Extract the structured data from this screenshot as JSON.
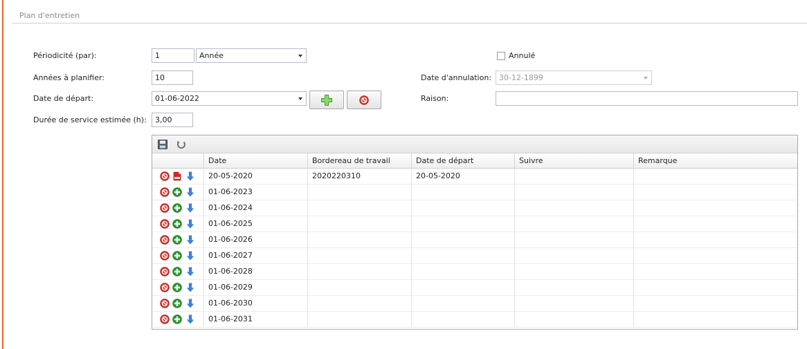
{
  "section": {
    "title": "Plan d'entretien"
  },
  "form": {
    "periodicity_label": "Périodicité (par):",
    "periodicity_value": "1",
    "periodicity_unit": "Année",
    "years_label": "Années à planifier:",
    "years_value": "10",
    "start_date_label": "Date de départ:",
    "start_date_value": "01-06-2022",
    "duration_label": "Durée de service estimée (h):",
    "duration_value": "3,00",
    "cancelled_label": "Annulé",
    "cancel_date_label": "Date d'annulation:",
    "cancel_date_value": "30-12-1899",
    "reason_label": "Raison:",
    "reason_value": ""
  },
  "grid": {
    "columns": [
      "Date",
      "Bordereau de travail",
      "Date de départ",
      "Suivre",
      "Remarque"
    ],
    "rows": [
      {
        "date": "20-05-2020",
        "work_order": "2020220310",
        "start_date": "20-05-2020",
        "follow": "",
        "remark": "",
        "type": "pdf"
      },
      {
        "date": "01-06-2023",
        "work_order": "",
        "start_date": "",
        "follow": "",
        "remark": "",
        "type": "add"
      },
      {
        "date": "01-06-2024",
        "work_order": "",
        "start_date": "",
        "follow": "",
        "remark": "",
        "type": "add"
      },
      {
        "date": "01-06-2025",
        "work_order": "",
        "start_date": "",
        "follow": "",
        "remark": "",
        "type": "add"
      },
      {
        "date": "01-06-2026",
        "work_order": "",
        "start_date": "",
        "follow": "",
        "remark": "",
        "type": "add"
      },
      {
        "date": "01-06-2027",
        "work_order": "",
        "start_date": "",
        "follow": "",
        "remark": "",
        "type": "add"
      },
      {
        "date": "01-06-2028",
        "work_order": "",
        "start_date": "",
        "follow": "",
        "remark": "",
        "type": "add"
      },
      {
        "date": "01-06-2029",
        "work_order": "",
        "start_date": "",
        "follow": "",
        "remark": "",
        "type": "add"
      },
      {
        "date": "01-06-2030",
        "work_order": "",
        "start_date": "",
        "follow": "",
        "remark": "",
        "type": "add"
      },
      {
        "date": "01-06-2031",
        "work_order": "",
        "start_date": "",
        "follow": "",
        "remark": "",
        "type": "add"
      }
    ]
  },
  "colors": {
    "accent": "#e8622a",
    "delete_red": "#d9342b",
    "add_green": "#2e9b2e",
    "arrow_blue": "#3b82d6"
  }
}
